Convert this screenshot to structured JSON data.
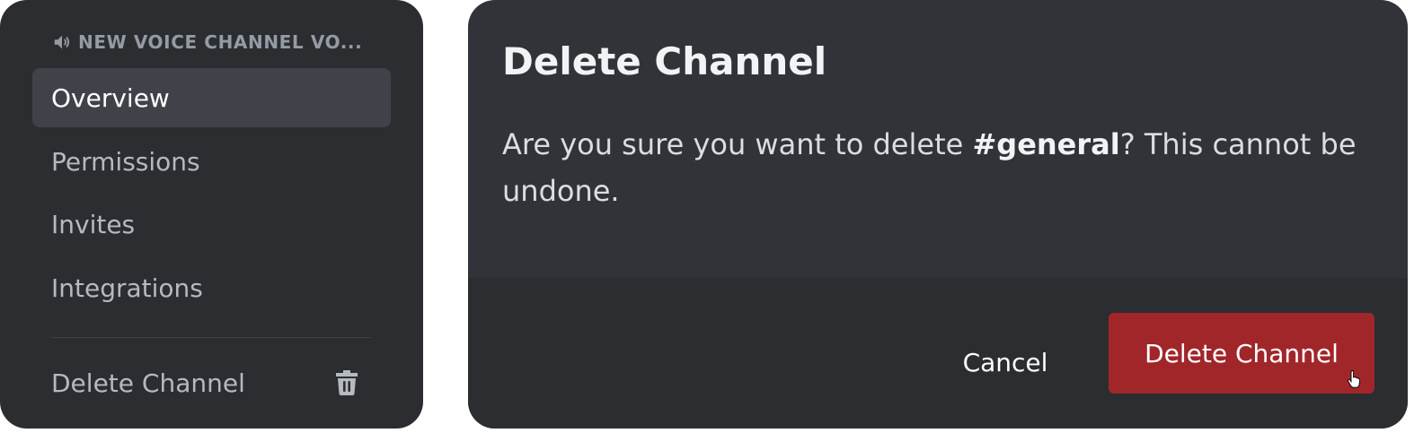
{
  "sidebar": {
    "header": "NEW VOICE CHANNEL VO...",
    "header_icon": "speaker-icon",
    "items": [
      {
        "label": "Overview",
        "active": true
      },
      {
        "label": "Permissions",
        "active": false
      },
      {
        "label": "Invites",
        "active": false
      },
      {
        "label": "Integrations",
        "active": false
      }
    ],
    "delete_label": "Delete Channel",
    "delete_icon": "trash-icon"
  },
  "modal": {
    "title": "Delete Channel",
    "body_prefix": "Are you sure you want to delete ",
    "channel_name": "#general",
    "body_suffix": "? This cannot be undone.",
    "cancel_label": "Cancel",
    "confirm_label": "Delete Channel"
  },
  "colors": {
    "sidebar_bg": "#2b2d31",
    "active_item_bg": "#404249",
    "modal_bg": "#313338",
    "footer_bg": "#2b2d31",
    "danger": "#a1262a",
    "muted_text": "#b5bac1"
  }
}
